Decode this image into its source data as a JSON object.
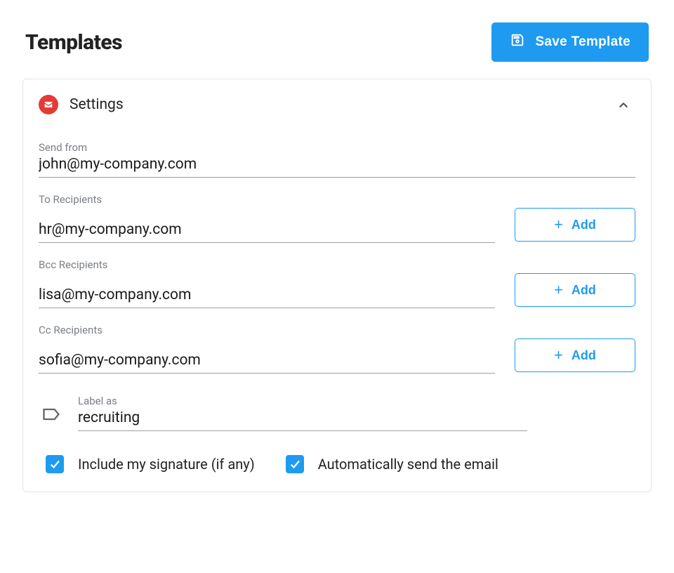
{
  "header": {
    "title": "Templates",
    "save_button": "Save Template"
  },
  "section": {
    "title": "Settings"
  },
  "fields": {
    "send_from": {
      "label": "Send from",
      "value": "john@my-company.com"
    },
    "to": {
      "label": "To Recipients",
      "value": "hr@my-company.com",
      "add_label": "Add"
    },
    "bcc": {
      "label": "Bcc Recipients",
      "value": "lisa@my-company.com",
      "add_label": "Add"
    },
    "cc": {
      "label": "Cc Recipients",
      "value": "sofia@my-company.com",
      "add_label": "Add"
    },
    "label_as": {
      "label": "Label as",
      "value": "recruiting"
    }
  },
  "checkboxes": {
    "signature": {
      "label": "Include my signature (if any)",
      "checked": true
    },
    "autosend": {
      "label": "Automatically send the email",
      "checked": true
    }
  }
}
